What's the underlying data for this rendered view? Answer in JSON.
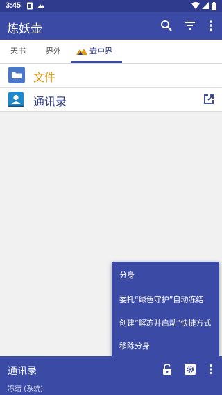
{
  "status_bar": {
    "time": "3:45",
    "left_icons": [
      "sim-card-icon",
      "cloud-icon"
    ],
    "right_icons": [
      "wifi-icon",
      "signal-icon",
      "battery-icon"
    ]
  },
  "app_bar": {
    "title": "炼妖壶",
    "actions": [
      "search-icon",
      "filter-icon",
      "more-vert-icon"
    ]
  },
  "tabs": [
    {
      "label": "天书",
      "active": false
    },
    {
      "label": "界外",
      "active": false
    },
    {
      "label": "壶中界",
      "active": true,
      "icon": "mountain-icon"
    }
  ],
  "list": [
    {
      "label": "文件",
      "icon": "folder-icon",
      "color": "#e39b12"
    },
    {
      "label": "通讯录",
      "icon": "contacts-icon",
      "color": "#2c3a8c",
      "trailing_icon": "open-external-icon"
    }
  ],
  "menu": {
    "items": [
      "分身",
      "委托“绿色守护”自动冻结",
      "创建“解冻并启动”快捷方式",
      "移除分身"
    ]
  },
  "bottom_panel": {
    "app_name": "通讯录",
    "status": "冻结 (系统)",
    "actions": [
      "lock-icon",
      "settings-icon",
      "more-vert-icon"
    ]
  },
  "colors": {
    "primary": "#3b4ba5",
    "primary_dark": "#2f3b8c",
    "accent": "#e39b12"
  }
}
